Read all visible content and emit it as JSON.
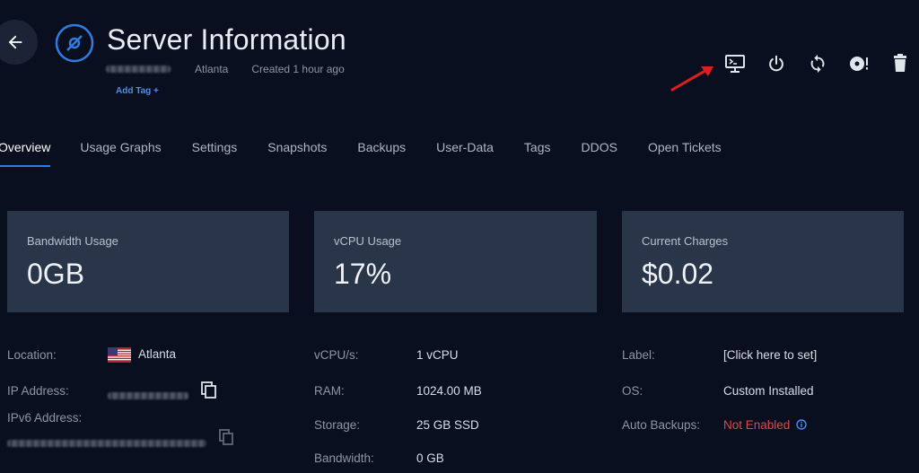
{
  "header": {
    "title": "Server Information",
    "location": "Atlanta",
    "created": "Created 1 hour ago",
    "add_tag": "Add Tag +"
  },
  "toolbar": {
    "icons": [
      "console-icon",
      "power-icon",
      "restart-icon",
      "reinstall-icon",
      "trash-icon"
    ]
  },
  "tabs": [
    "Overview",
    "Usage Graphs",
    "Settings",
    "Snapshots",
    "Backups",
    "User-Data",
    "Tags",
    "DDOS",
    "Open Tickets"
  ],
  "cards": [
    {
      "title": "Bandwidth Usage",
      "value": "0GB"
    },
    {
      "title": "vCPU Usage",
      "value": "17%"
    },
    {
      "title": "Current Charges",
      "value": "$0.02"
    }
  ],
  "details": {
    "col1": {
      "location_label": "Location:",
      "location_value": "Atlanta",
      "ip_label": "IP Address:",
      "ipv6_label": "IPv6 Address:"
    },
    "col2": {
      "vcpu_label": "vCPU/s:",
      "vcpu_value": "1 vCPU",
      "ram_label": "RAM:",
      "ram_value": "1024.00 MB",
      "storage_label": "Storage:",
      "storage_value": "25 GB SSD",
      "bandwidth_label": "Bandwidth:",
      "bandwidth_value": "0 GB"
    },
    "col3": {
      "label_label": "Label:",
      "label_value": "[Click here to set]",
      "os_label": "OS:",
      "os_value": "Custom Installed",
      "backups_label": "Auto Backups:",
      "backups_value": "Not Enabled"
    }
  },
  "colors": {
    "background": "#0a0f1f",
    "card": "#29364a",
    "accent": "#2f7de1",
    "link": "#4a8df0",
    "warning": "#e0474c",
    "annotation_arrow": "#e01e1e"
  }
}
